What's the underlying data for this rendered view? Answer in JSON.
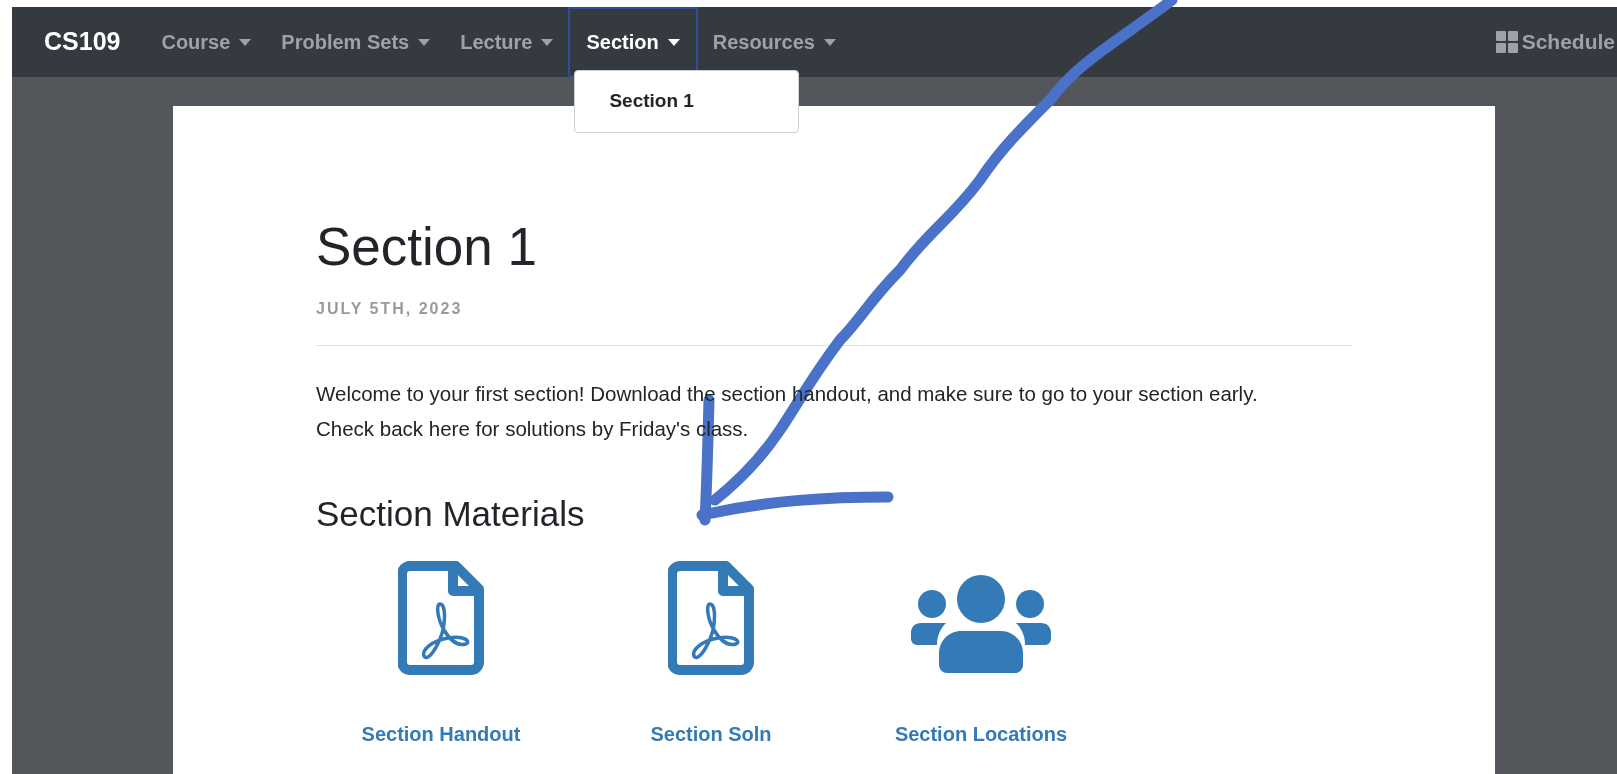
{
  "brand": "CS109",
  "nav": [
    {
      "label": "Course",
      "selected": false
    },
    {
      "label": "Problem Sets",
      "selected": false
    },
    {
      "label": "Lecture",
      "selected": false
    },
    {
      "label": "Section",
      "selected": true
    },
    {
      "label": "Resources",
      "selected": false
    }
  ],
  "nav_right": {
    "label": "Schedule"
  },
  "dropdown": {
    "items": [
      "Section 1"
    ]
  },
  "page": {
    "title": "Section 1",
    "date": "JULY 5TH, 2023",
    "intro": "Welcome to your first section! Download the section handout, and make sure to go to your section early. Check back here for solutions by Friday's class.",
    "materials_heading": "Section Materials",
    "materials": [
      {
        "label": "Section Handout",
        "kind": "pdf"
      },
      {
        "label": "Section Soln",
        "kind": "pdf"
      },
      {
        "label": "Section Locations",
        "kind": "people"
      }
    ]
  }
}
